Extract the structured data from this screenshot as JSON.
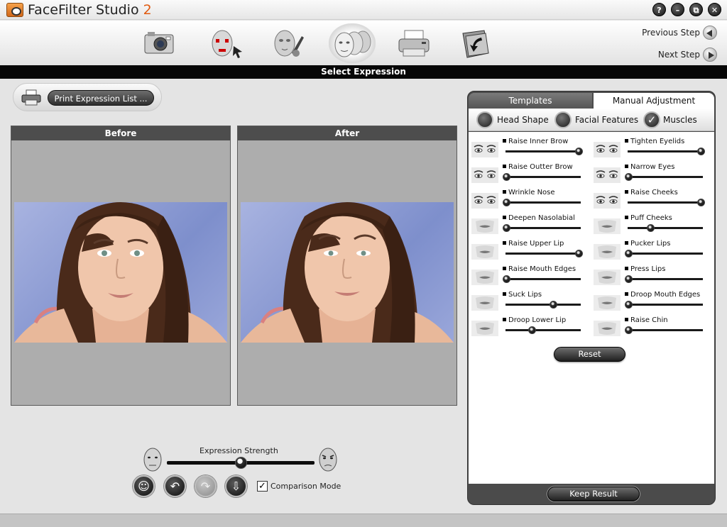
{
  "app": {
    "name": "FaceFilter Studio",
    "version": "2"
  },
  "window_buttons": [
    {
      "name": "help",
      "glyph": "?"
    },
    {
      "name": "minimize",
      "glyph": "–"
    },
    {
      "name": "restore",
      "glyph": "⧉"
    },
    {
      "name": "close",
      "glyph": "✕"
    }
  ],
  "toolbar": {
    "steps": [
      {
        "icon": "camera-icon",
        "active": false
      },
      {
        "icon": "face-marker-icon",
        "active": false
      },
      {
        "icon": "face-paint-icon",
        "active": false
      },
      {
        "icon": "faces-expression-icon",
        "active": true
      },
      {
        "icon": "printer-icon",
        "active": false
      },
      {
        "icon": "export-folder-icon",
        "active": false
      }
    ],
    "previous_step": "Previous Step",
    "next_step": "Next Step"
  },
  "step_title": "Select Expression",
  "print_button": "Print Expression List ...",
  "panels": {
    "before": "Before",
    "after": "After"
  },
  "expression": {
    "label": "Expression Strength",
    "strength": 0.5,
    "comparison_mode_label": "Comparison Mode",
    "comparison_mode_checked": true,
    "check_glyph": "✓"
  },
  "right_panel": {
    "tabs": {
      "templates": "Templates",
      "manual": "Manual Adjustment"
    },
    "subtabs": {
      "head_shape": "Head Shape",
      "facial_features": "Facial Features",
      "muscles": "Muscles"
    },
    "reset": "Reset",
    "keep_result": "Keep Result",
    "muscles": [
      {
        "label": "Raise Inner Brow",
        "value": 1.0,
        "icon": "eyes-brow-icon"
      },
      {
        "label": "Tighten Eyelids",
        "value": 1.0,
        "icon": "eyes-brow-icon"
      },
      {
        "label": "Raise Outter Brow",
        "value": 0.0,
        "icon": "eyes-brow-icon"
      },
      {
        "label": "Narrow Eyes",
        "value": 0.0,
        "icon": "eyes-brow-icon"
      },
      {
        "label": "Wrinkle Nose",
        "value": 0.0,
        "icon": "eyes-brow-icon"
      },
      {
        "label": "Raise Cheeks",
        "value": 1.0,
        "icon": "eyes-brow-icon"
      },
      {
        "label": "Deepen Nasolabial",
        "value": 0.0,
        "icon": "mouth-icon"
      },
      {
        "label": "Puff Cheeks",
        "value": 0.3,
        "icon": "mouth-icon"
      },
      {
        "label": "Raise Upper Lip",
        "value": 1.0,
        "icon": "mouth-icon"
      },
      {
        "label": "Pucker Lips",
        "value": 0.0,
        "icon": "mouth-icon"
      },
      {
        "label": "Raise Mouth Edges",
        "value": 0.0,
        "icon": "mouth-icon"
      },
      {
        "label": "Press Lips",
        "value": 0.0,
        "icon": "mouth-icon"
      },
      {
        "label": "Suck Lips",
        "value": 0.65,
        "icon": "mouth-icon"
      },
      {
        "label": "Droop Mouth Edges",
        "value": 0.0,
        "icon": "mouth-icon"
      },
      {
        "label": "Droop Lower Lip",
        "value": 0.35,
        "icon": "mouth-icon"
      },
      {
        "label": "Raise Chin",
        "value": 0.0,
        "icon": "mouth-icon"
      }
    ]
  }
}
